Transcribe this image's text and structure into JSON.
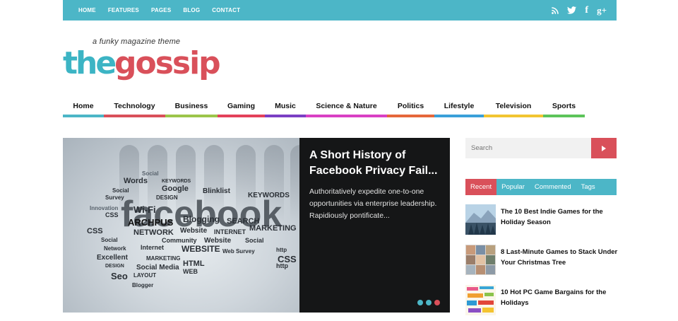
{
  "topbar": {
    "links": [
      "HOME",
      "FEATURES",
      "PAGES",
      "BLOG",
      "CONTACT"
    ],
    "social_icons": [
      "rss-icon",
      "twitter-icon",
      "facebook-icon",
      "google-plus-icon"
    ],
    "glyph_twitter": "🐦",
    "glyph_facebook": "f",
    "glyph_gplus": "g+",
    "color": "#4cb6c7"
  },
  "logo": {
    "tagline": "a funky magazine theme",
    "part1": "the",
    "part2": "gossip",
    "color_teal": "#3cb4c4",
    "color_red": "#d9505a"
  },
  "nav": {
    "items": [
      {
        "label": "Home",
        "color": "#4cb6c7"
      },
      {
        "label": "Technology",
        "color": "#d9505a"
      },
      {
        "label": "Business",
        "color": "#9cc54a"
      },
      {
        "label": "Gaming",
        "color": "#e3415a"
      },
      {
        "label": "Music",
        "color": "#7b3fc4"
      },
      {
        "label": "Science & Nature",
        "color": "#d940c4"
      },
      {
        "label": "Politics",
        "color": "#e5673a"
      },
      {
        "label": "Lifestyle",
        "color": "#3aa0d9"
      },
      {
        "label": "Television",
        "color": "#f2c531"
      },
      {
        "label": "Sports",
        "color": "#5cc45a"
      }
    ]
  },
  "slider": {
    "title": "A Short History of Facebook Privacy Fail...",
    "excerpt": "Authoritatively expedite one-to-one opportunities via enterprise leadership. Rapidiously pontificate...",
    "dot_colors": [
      "#4cb6c7",
      "#4cb6c7",
      "#d9505a"
    ]
  },
  "search": {
    "placeholder": "Search"
  },
  "sidebar_tabs": [
    {
      "label": "Recent",
      "active": true
    },
    {
      "label": "Popular",
      "active": false
    },
    {
      "label": "Commented",
      "active": false
    },
    {
      "label": "Tags",
      "active": false
    }
  ],
  "posts": [
    {
      "title": "The 10 Best Indie Games for the Holiday Season",
      "thumb": "mountain-forest"
    },
    {
      "title": "8 Last-Minute Games to Stack Under Your Christmas Tree",
      "thumb": "photo-collage"
    },
    {
      "title": "10 Hot PC Game Bargains for the Holidays",
      "thumb": "social-media-words"
    }
  ]
}
